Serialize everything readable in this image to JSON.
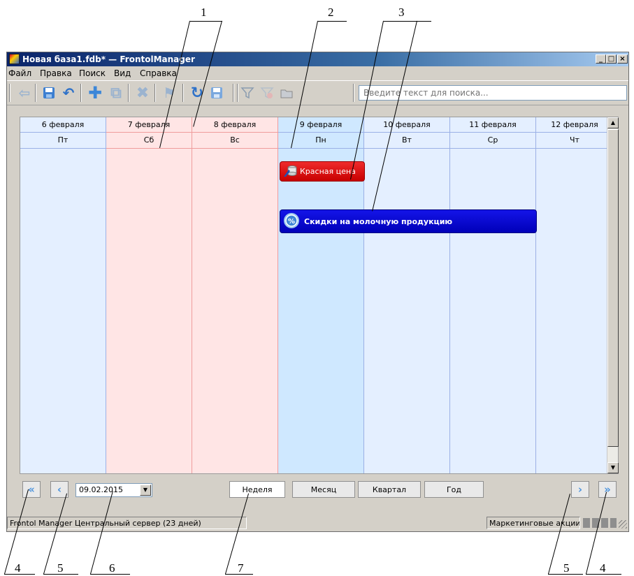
{
  "callouts": [
    "1",
    "2",
    "3",
    "4",
    "5",
    "6",
    "7",
    "5",
    "4"
  ],
  "window": {
    "title": "Новая база1.fdb* — FrontolManager"
  },
  "menu": [
    "Файл",
    "Правка",
    "Поиск",
    "Вид",
    "Справка"
  ],
  "toolbar": {
    "icons": [
      "back-arrow-icon",
      "save-icon",
      "undo-icon",
      "add-icon",
      "add-copy-icon",
      "delete-icon",
      "flag-icon",
      "refresh-icon",
      "save-as-icon",
      "filter-icon",
      "clear-filter-icon",
      "folder-icon"
    ],
    "search_placeholder": "Введите текст для поиска..."
  },
  "calendar": {
    "dates": [
      "6 февраля",
      "7 февраля",
      "8 февраля",
      "9 февраля",
      "10 февраля",
      "11 февраля",
      "12 февраля"
    ],
    "weekdays": [
      "Пт",
      "Сб",
      "Вс",
      "Пн",
      "Вт",
      "Ср",
      "Чт"
    ],
    "colors": {
      "weekday": "#e4efff",
      "weekend": "#ffe5e5",
      "today": "#cfe8ff",
      "event_red": "#d50000",
      "event_blue": "#0000d0"
    },
    "events": [
      {
        "label": "Красная цена",
        "icon": "coins-icon"
      },
      {
        "label": "Скидки на молочную продукцию",
        "icon": "discount-icon"
      }
    ]
  },
  "controls": {
    "date_value": "09.02.2015",
    "views": [
      "Неделя",
      "Месяц",
      "Квартал",
      "Год"
    ]
  },
  "status": {
    "left": "Frontol Manager Центральный сервер (23 дней)",
    "right": "Маркетинговые акции"
  }
}
